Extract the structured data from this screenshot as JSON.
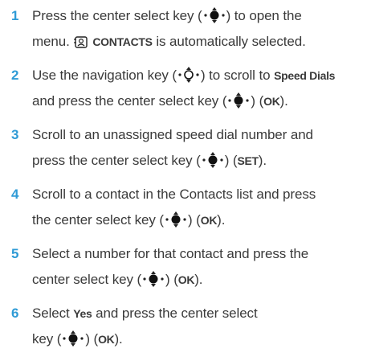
{
  "steps": [
    {
      "number": "1",
      "l1_a": "Press the center select key (",
      "l1_b": ") to open the",
      "l2_a": "menu.",
      "l2_b": "CONTACTS",
      "l2_c": "is automatically selected."
    },
    {
      "number": "2",
      "l1_a": "Use the navigation key (",
      "l1_b": ") to scroll to",
      "l1_c": "Speed Dials",
      "l2_a": "and press the center select key (",
      "l2_b": ") (",
      "l2_c": "OK",
      "l2_d": ")."
    },
    {
      "number": "3",
      "l1_a": "Scroll to an unassigned speed dial number and",
      "l2_a": "press the center select key (",
      "l2_b": ") (",
      "l2_c": "SET",
      "l2_d": ")."
    },
    {
      "number": "4",
      "l1_a": "Scroll to a contact in the Contacts list and press",
      "l2_a": "the center select key (",
      "l2_b": ") (",
      "l2_c": "OK",
      "l2_d": ")."
    },
    {
      "number": "5",
      "l1_a": "Select a number for that contact and press the",
      "l2_a": "center select key (",
      "l2_b": ") (",
      "l2_c": "OK",
      "l2_d": ")."
    },
    {
      "number": "6",
      "l1_a": "Select",
      "l1_b": "Yes",
      "l1_c": "and press the center select",
      "l2_a": "key (",
      "l2_b": ") (",
      "l2_c": "OK",
      "l2_d": ")."
    }
  ],
  "colors": {
    "accent": "#2f9bd6",
    "text": "#3a3a3a"
  }
}
